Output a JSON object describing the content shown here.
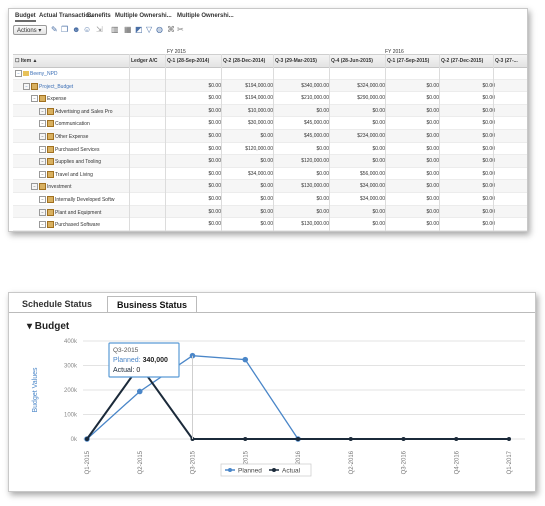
{
  "top_tabs": [
    {
      "label": "Budget",
      "active": true
    },
    {
      "label": "Actual Transactio...",
      "active": false
    },
    {
      "label": "Benefits",
      "active": false
    },
    {
      "label": "Multiple Ownershi...",
      "active": false
    },
    {
      "label": "Multiple Ownershi...",
      "active": false
    }
  ],
  "toolbar": {
    "actions_label": "Actions ▾",
    "icons": [
      "edit-icon",
      "new-window-icon",
      "users-icon",
      "user-add-icon",
      "export-icon",
      "columns-icon",
      "grid-icon",
      "chart-icon",
      "filter-icon",
      "refresh-icon",
      "clear-filter-icon",
      "tools-icon"
    ]
  },
  "grid": {
    "fy_labels": [
      "FY 2015",
      "FY 2016"
    ],
    "headers": [
      "Item ▲",
      "Ledger A/C",
      "Q-1 (28-Sep-2014)",
      "Q-2 (28-Dec-2014)",
      "Q-3 (29-Mar-2015)",
      "Q-4 (28-Jun-2015)",
      "Q-1 (27-Sep-2015)",
      "Q-2 (27-Dec-2015)",
      "Q-3 (27-..."
    ],
    "rows": [
      {
        "item": "Beeny_NPD",
        "link": true,
        "values": [
          "",
          "",
          "",
          "",
          "",
          "",
          ""
        ]
      },
      {
        "item": "Project_Budget",
        "link": true,
        "values": [
          "$0.00",
          "$194,000.00",
          "$340,000.00",
          "$324,000.00",
          "$0.00",
          "$0.00",
          ""
        ]
      },
      {
        "item": "Expense",
        "link": false,
        "values": [
          "$0.00",
          "$194,000.00",
          "$210,000.00",
          "$290,000.00",
          "$0.00",
          "$0.00",
          ""
        ]
      },
      {
        "item": "Advertising and Sales Pro",
        "link": false,
        "values": [
          "$0.00",
          "$10,000.00",
          "$0.00",
          "$0.00",
          "$0.00",
          "$0.00",
          ""
        ]
      },
      {
        "item": "Communication",
        "link": false,
        "values": [
          "$0.00",
          "$30,000.00",
          "$45,000.00",
          "$0.00",
          "$0.00",
          "$0.00",
          ""
        ]
      },
      {
        "item": "Other Expense",
        "link": false,
        "values": [
          "$0.00",
          "$0.00",
          "$45,000.00",
          "$234,000.00",
          "$0.00",
          "$0.00",
          ""
        ]
      },
      {
        "item": "Purchased Services",
        "link": false,
        "values": [
          "$0.00",
          "$120,000.00",
          "$0.00",
          "$0.00",
          "$0.00",
          "$0.00",
          ""
        ]
      },
      {
        "item": "Supplies and Tooling",
        "link": false,
        "values": [
          "$0.00",
          "$0.00",
          "$120,000.00",
          "$0.00",
          "$0.00",
          "$0.00",
          ""
        ]
      },
      {
        "item": "Travel and Living",
        "link": false,
        "values": [
          "$0.00",
          "$34,000.00",
          "$0.00",
          "$56,000.00",
          "$0.00",
          "$0.00",
          ""
        ]
      },
      {
        "item": "Investment",
        "link": false,
        "values": [
          "$0.00",
          "$0.00",
          "$130,000.00",
          "$34,000.00",
          "$0.00",
          "$0.00",
          ""
        ]
      },
      {
        "item": "Internally Developed Softw",
        "link": false,
        "values": [
          "$0.00",
          "$0.00",
          "$0.00",
          "$34,000.00",
          "$0.00",
          "$0.00",
          ""
        ]
      },
      {
        "item": "Plant and Equipment",
        "link": false,
        "values": [
          "$0.00",
          "$0.00",
          "$0.00",
          "$0.00",
          "$0.00",
          "$0.00",
          ""
        ]
      },
      {
        "item": "Purchased Software",
        "link": false,
        "values": [
          "$0.00",
          "$0.00",
          "$130,000.00",
          "$0.00",
          "$0.00",
          "$0.00",
          ""
        ]
      }
    ]
  },
  "status_tabs": [
    {
      "label": "Schedule Status",
      "active": false
    },
    {
      "label": "Business Status",
      "active": true
    }
  ],
  "budget_title": "▾ Budget",
  "tooltip": {
    "quarter": "Q3-2015",
    "planned_label": "Planned: ",
    "planned_value": "340,000",
    "actual_label": "Actual: ",
    "actual_value": "0"
  },
  "colors": {
    "planned": "#4a86c8",
    "actual": "#1b2a3a",
    "link": "#3b6fb6"
  },
  "chart_data": {
    "type": "line",
    "title": "Budget",
    "ylabel": "Budget Values",
    "xlabel": "",
    "categories": [
      "Q1-2015",
      "Q2-2015",
      "Q3-2015",
      "Q4-2015",
      "Q1-2016",
      "Q2-2016",
      "Q3-2016",
      "Q4-2016",
      "Q1-2017"
    ],
    "ytick_labels": [
      "0k",
      "100k",
      "200k",
      "300k",
      "400k"
    ],
    "ylim": [
      0,
      400000
    ],
    "series": [
      {
        "name": "Planned",
        "values": [
          0,
          194000,
          340000,
          324000,
          0,
          null,
          null,
          null,
          null
        ]
      },
      {
        "name": "Actual",
        "values": [
          0,
          300000,
          0,
          0,
          0,
          0,
          0,
          0,
          0
        ]
      }
    ],
    "legend": "bottom",
    "grid": true
  }
}
